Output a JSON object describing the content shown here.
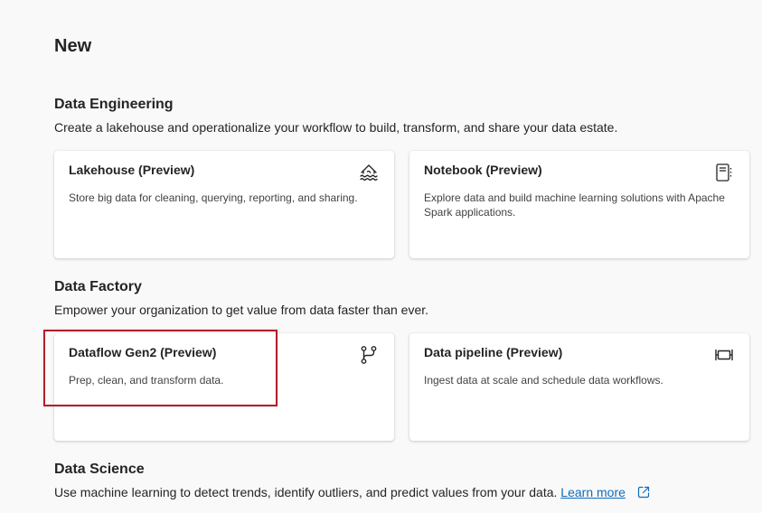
{
  "page": {
    "title": "New"
  },
  "sections": [
    {
      "title": "Data Engineering",
      "description": "Create a lakehouse and operationalize your workflow to build, transform, and share your data estate.",
      "cards": [
        {
          "title": "Lakehouse (Preview)",
          "description": "Store big data for cleaning, querying, reporting, and sharing.",
          "icon": "lakehouse-icon"
        },
        {
          "title": "Notebook (Preview)",
          "description": "Explore data and build machine learning solutions with Apache Spark applications.",
          "icon": "notebook-icon"
        }
      ]
    },
    {
      "title": "Data Factory",
      "description": "Empower your organization to get value from data faster than ever.",
      "cards": [
        {
          "title": "Dataflow Gen2 (Preview)",
          "description": "Prep, clean, and transform data.",
          "icon": "dataflow-branch-icon",
          "highlighted": true
        },
        {
          "title": "Data pipeline (Preview)",
          "description": "Ingest data at scale and schedule data workflows.",
          "icon": "pipeline-icon"
        }
      ]
    },
    {
      "title": "Data Science",
      "description": "Use machine learning to detect trends, identify outliers, and predict values from your data.",
      "link_label": "Learn more",
      "link_icon": "external-link-icon"
    }
  ],
  "colors": {
    "background": "#f9f9f9",
    "card": "#ffffff",
    "text": "#242424",
    "link": "#0f6cbd",
    "highlight_border": "#b0202a"
  }
}
